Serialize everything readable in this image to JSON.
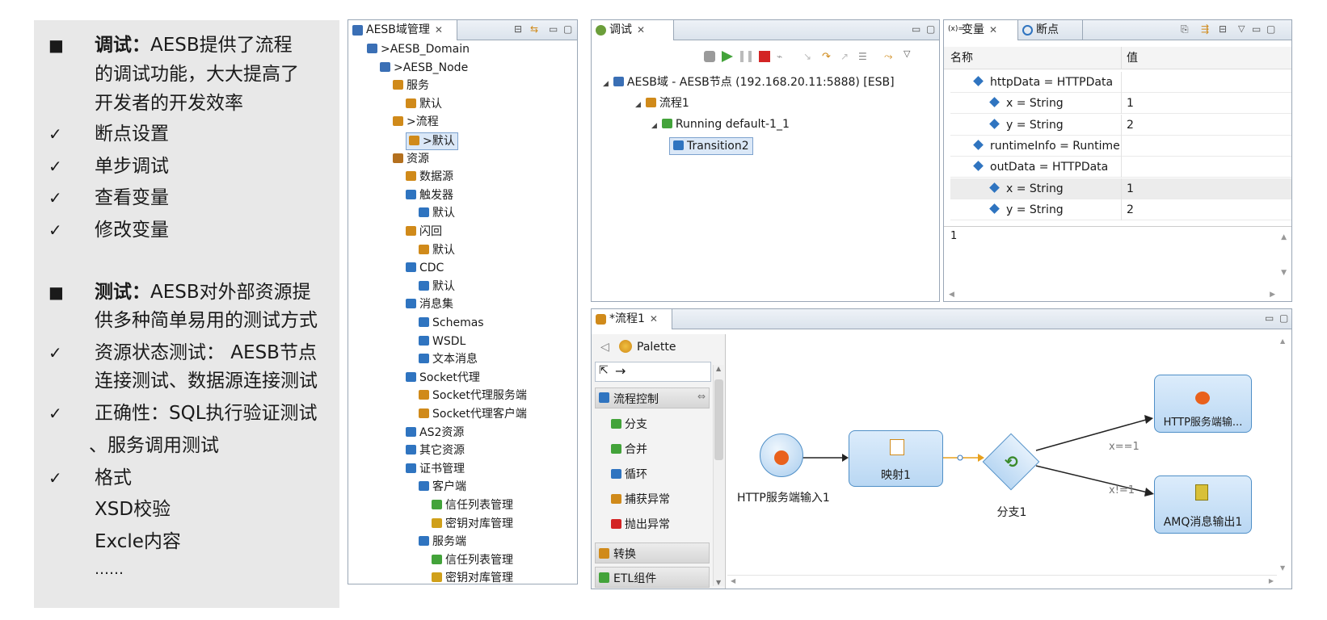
{
  "bullets": {
    "debug_title": "调试：",
    "debug_line1": "AESB提供了流程",
    "debug_line2": "的调试功能，大大提高了",
    "debug_line3": "开发者的开发效率",
    "debug_checks": [
      "断点设置",
      "单步调试",
      "查看变量",
      "修改变量"
    ],
    "test_title": "测试：",
    "test_line1": "AESB对外部资源提",
    "test_line2": "供多种简单易用的测试方式",
    "check_resource_1": "资源状态测试： AESB节点",
    "check_resource_2": "连接测试、数据源连接测试",
    "check_correct_1": "正确性：SQL执行验证测试",
    "check_correct_2": "、服务调用测试",
    "check_format": "格式",
    "format_1": "XSD校验",
    "format_2": "Excle内容",
    "ellipsis": "……",
    "square_mark": "■",
    "check_mark": "✓"
  },
  "domain_view": {
    "tab_label": "AESB域管理",
    "tree": [
      {
        "label": ">AESB_Domain",
        "icon": "domain-icon"
      },
      {
        "label": ">AESB_Node",
        "icon": "node-icon"
      },
      {
        "label": "服务",
        "icon": "service-folder-icon"
      },
      {
        "label": "默认",
        "icon": "default-icon"
      },
      {
        "label": ">流程",
        "icon": "flow-folder-icon"
      },
      {
        "label": ">默认",
        "icon": "default-icon"
      },
      {
        "label": "资源",
        "icon": "resource-icon"
      },
      {
        "label": "数据源",
        "icon": "datasource-icon"
      },
      {
        "label": "触发器",
        "icon": "trigger-icon"
      },
      {
        "label": "默认",
        "icon": "default-icon"
      },
      {
        "label": "闪回",
        "icon": "flashback-icon"
      },
      {
        "label": "默认",
        "icon": "default-icon"
      },
      {
        "label": "CDC",
        "icon": "cdc-icon"
      },
      {
        "label": "默认",
        "icon": "default-icon"
      },
      {
        "label": "消息集",
        "icon": "message-set-icon"
      },
      {
        "label": "Schemas",
        "icon": "schema-icon"
      },
      {
        "label": "WSDL",
        "icon": "wsdl-icon"
      },
      {
        "label": "文本消息",
        "icon": "text-message-icon"
      },
      {
        "label": "Socket代理",
        "icon": "socket-icon"
      },
      {
        "label": "Socket代理服务端",
        "icon": "socket-server-icon"
      },
      {
        "label": "Socket代理客户端",
        "icon": "socket-client-icon"
      },
      {
        "label": "AS2资源",
        "icon": "as2-icon"
      },
      {
        "label": "其它资源",
        "icon": "other-resource-icon"
      },
      {
        "label": "证书管理",
        "icon": "certificate-icon"
      },
      {
        "label": "客户端",
        "icon": "client-icon"
      },
      {
        "label": "信任列表管理",
        "icon": "trust-list-icon"
      },
      {
        "label": "密钥对库管理",
        "icon": "keystore-icon"
      },
      {
        "label": "服务端",
        "icon": "server-icon"
      },
      {
        "label": "信任列表管理",
        "icon": "trust-list-icon"
      },
      {
        "label": "密钥对库管理",
        "icon": "keystore-icon"
      }
    ]
  },
  "debug_view": {
    "tab_label": "调试",
    "tree": [
      {
        "label": "AESB域 - AESB节点 (192.168.20.11:5888) [ESB]"
      },
      {
        "label": "流程1"
      },
      {
        "label": "Running default-1_1"
      },
      {
        "label": "Transition2"
      }
    ]
  },
  "variables_view": {
    "tab_label": "变量",
    "tab_label_2": "断点",
    "col_name": "名称",
    "col_value": "值",
    "rows": [
      {
        "name": "httpData  =  HTTPData",
        "value": ""
      },
      {
        "name": "x  =  String",
        "value": "1"
      },
      {
        "name": "y  =  String",
        "value": "2"
      },
      {
        "name": "runtimeInfo  =  RuntimeInfo",
        "value": ""
      },
      {
        "name": "outData  =  HTTPData",
        "value": ""
      },
      {
        "name": "x  =  String",
        "value": "1"
      },
      {
        "name": "y  =  String",
        "value": "2"
      }
    ],
    "detail_value": "1"
  },
  "flow_view": {
    "tab_label": "*流程1",
    "palette_label": "Palette",
    "palette_groups": {
      "flow_control": "流程控制",
      "transform": "转换",
      "etl": "ETL组件"
    },
    "palette_items": [
      "分支",
      "合并",
      "循环",
      "捕获异常",
      "抛出异常"
    ],
    "nodes": {
      "http_in": "HTTP服务端输入1",
      "mapping": "映射1",
      "branch": "分支1",
      "http_out": "HTTP服务端输...",
      "amq_out": "AMQ消息输出1"
    },
    "conditions": {
      "eq": "x==1",
      "neq": "x!=1"
    }
  },
  "colors": {
    "panel_bg": "#e8e8e8",
    "view_border": "#9aa7b6",
    "node_fill": "#c9e1f7",
    "node_border": "#4f8fc7",
    "selection": "#dbe8f7"
  }
}
